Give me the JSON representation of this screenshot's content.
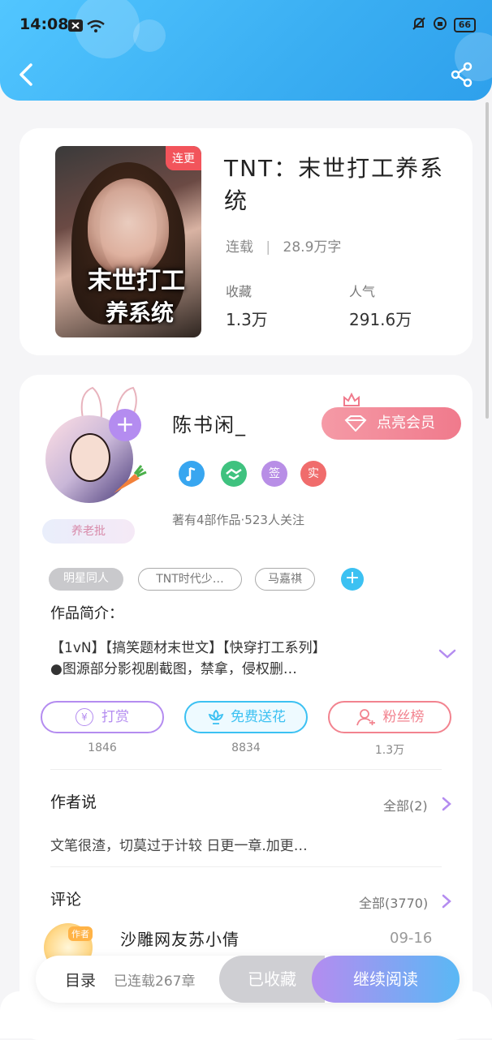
{
  "status_bar": {
    "time": "14:08",
    "battery": "66"
  },
  "book": {
    "title": "TNT：末世打工养系统",
    "cover_badge": "连更",
    "cover_title_line1": "末世打工",
    "cover_title_line2": "养系统",
    "status": "连载",
    "word_count": "28.9万字",
    "collect_label": "收藏",
    "collect_value": "1.3万",
    "popularity_label": "人气",
    "popularity_value": "291.6万"
  },
  "author": {
    "name": "陈书闲_",
    "vip_button": "点亮会员",
    "fan_tag": "养老批",
    "works_info": "著有4部作品·523人关注",
    "badges": [
      {
        "icon": "note-badge-icon",
        "color": "#38a6f0"
      },
      {
        "icon": "handshake-badge-icon",
        "color": "#3fc27f"
      },
      {
        "label": "签",
        "color": "#b88ee6"
      },
      {
        "label": "实",
        "color": "#f06c6c"
      }
    ]
  },
  "tags": [
    "明星同人",
    "TNT时代少…",
    "马嘉祺"
  ],
  "intro": {
    "heading": "作品简介：",
    "line1": "【1vN】【搞笑题材末世文】【快穿打工系列】",
    "line2": "●图源部分影视剧截图，禁拿，侵权删…"
  },
  "actions": [
    {
      "label": "打赏",
      "count": "1846",
      "color": "#b48cf0"
    },
    {
      "label": "免费送花",
      "count": "8834",
      "color": "#3cc1f2"
    },
    {
      "label": "粉丝榜",
      "count": "1.3万",
      "color": "#f2838f"
    }
  ],
  "author_says": {
    "title": "作者说",
    "more": "全部(2)",
    "text": "文笔很渣，切莫过于计较 日更一章.加更…"
  },
  "comments": {
    "title": "评论",
    "more": "全部(3770)",
    "first": {
      "badge": "作者",
      "user": "沙雕网友苏小倩",
      "date": "09-16"
    }
  },
  "bottom_bar": {
    "toc": "目录",
    "chapter_status": "已连载267章",
    "collected": "已收藏",
    "continue": "继续阅读"
  },
  "colors": {
    "header": "#3aaef2",
    "accent_purple": "#b48cf0",
    "accent_blue": "#3cc1f2",
    "vip_pink": "#f07a8c"
  }
}
